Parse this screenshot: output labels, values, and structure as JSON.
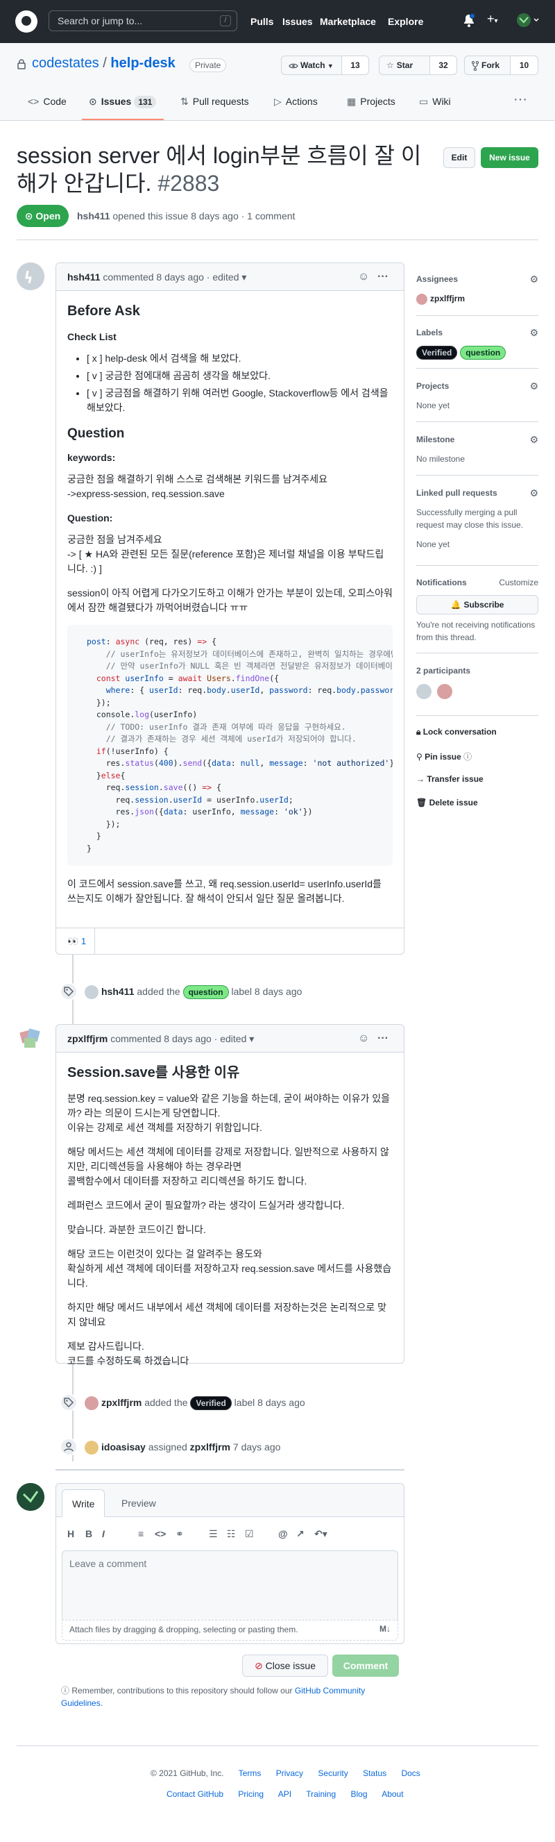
{
  "header": {
    "search_placeholder": "Search or jump to...",
    "slash_key": "/",
    "nav": [
      "Pulls",
      "Issues",
      "Marketplace",
      "Explore"
    ],
    "plus_label": "+",
    "caret": "▾"
  },
  "repo": {
    "owner": "codestates",
    "separator": "/",
    "name": "help-desk",
    "visibility": "Private",
    "watch_label": "Watch",
    "watch_count": "13",
    "star_label": "Star",
    "star_count": "32",
    "fork_label": "Fork",
    "fork_count": "10",
    "tabs": {
      "code": "Code",
      "issues": "Issues",
      "issues_count": "131",
      "pulls": "Pull requests",
      "actions": "Actions",
      "projects": "Projects",
      "wiki": "Wiki"
    }
  },
  "issue": {
    "title": "session server 에서 login부분 흐름이 잘 이해가 안갑니다.",
    "number": "#2883",
    "edit_label": "Edit",
    "new_issue_label": "New issue",
    "state": "Open",
    "author": "hsh411",
    "meta": "opened this issue 8 days ago · 1 comment"
  },
  "comment1": {
    "author": "hsh411",
    "meta": "commented 8 days ago · edited ▾",
    "h_before": "Before Ask",
    "h_checklist": "Check List",
    "checks": [
      "[ x ] help-desk 에서 검색을 해 보았다.",
      "[ v ] 궁금한 점에대해 곰곰히 생각을 해보았다.",
      "[ v ] 궁금점을 해결하기 위해 여러번 Google, Stackoverflow등 에서 검색을 해보았다."
    ],
    "h_question": "Question",
    "h_keywords": "keywords:",
    "keywords_hint": "궁금한 점을 해결하기 위해 스스로 검색해본 키워드를 남겨주세요",
    "keywords_value": "->express-session, req.session.save",
    "h_question2": "Question:",
    "question_hint": "궁금한 점을 남겨주세요",
    "question_note": "-> [ ★ HA와 관련된 모든 질문(reference 포함)은 제너럴 채널을 이용 부탁드립니다. :) ]",
    "question_body": "session이 아직 어렵게 다가오기도하고 이해가 안가는 부분이 있는데, 오피스아워에서 잠깐 해결됐다가 까먹어버렸습니다 ㅠㅠ",
    "after_code": "이 코드에서 session.save를 쓰고, 왜 req.session.userId= userInfo.userId를 쓰는지도 이해가 잘안됩니다. 잘 해석이 안되서 일단 질문 올려봅니다.",
    "reaction_emoji": "👀",
    "reaction_count": "1",
    "code_lines": [
      "post: async (req, res) => {",
      "  // userInfo는 유저정보가 데이터베이스에 존재하고, 완벽히 일치하는 경우에만 데이터가 존재합니다.",
      "  // 만약 userInfo가 NULL 혹은 빈 객체라면 전달받은 유저정보가 데이터베이스에 존재하는지 확인해 보세요",
      "  const userInfo = await Users.findOne({",
      "    where: { userId: req.body.userId, password: req.body.password },",
      "  });",
      "  console.log(userInfo)",
      "  // TODO: userInfo 결과 존재 여부에 따라 응답을 구현하세요.",
      "  // 결과가 존재하는 경우 세션 객체에 userId가 저장되어야 합니다.",
      "  if(!userInfo) {",
      "    res.status(400).send({data: null, message: 'not authorized'});",
      "  }else{",
      "    req.session.save(() => {",
      "      req.session.userId = userInfo.userId;",
      "      res.json({data: userInfo, message: 'ok'})",
      "    });",
      "  }",
      "}"
    ]
  },
  "event1": {
    "actor": "hsh411",
    "text1": "added the",
    "label": "question",
    "text2": "label 8 days ago"
  },
  "comment2": {
    "author": "zpxlffjrm",
    "meta": "commented 8 days ago · edited ▾",
    "h1": "Session.save를 사용한 이유",
    "p1a": "분명 req.session.key = value와 같은 기능을 하는데, 굳이 써야하는 이유가 있을까? 라는 의문이 드시는게 당연합니다.",
    "p1b": "이유는 강제로 세션 객체를 저장하기 위함입니다.",
    "p2a": "해당 메서드는 세션 객체에 데이터를 강제로 저장합니다. 일반적으로 사용하지 않지만, 리디렉션등을 사용해야 하는 경우라면",
    "p2b": "콜백함수에서 데이터를 저장하고 리디렉션을 하기도 합니다.",
    "p3": "레퍼런스 코드에서 굳이 필요할까? 라는 생각이 드실거라 생각합니다.",
    "p4": "맞습니다. 과분한 코드이긴 합니다.",
    "p5a": "해당 코드는 이런것이 있다는 걸 알려주는 용도와",
    "p5b": "확실하게 세션 객체에 데이터를 저장하고자 req.session.save 메서드를 사용했습니다.",
    "p6": "하지만 해당 메서드 내부에서 세션 객체에 데이터를 저장하는것은 논리적으로 맞지 않네요",
    "p7a": "제보 감사드립니다.",
    "p7b": "코드를 수정하도록 하겠습니다"
  },
  "event2": {
    "actor": "zpxlffjrm",
    "text1": "added the",
    "label": "Verified",
    "text2": "label 8 days ago"
  },
  "event3": {
    "actor": "idoasisay",
    "text1": "assigned",
    "target": "zpxlffjrm",
    "text2": "7 days ago"
  },
  "composer": {
    "tab_write": "Write",
    "tab_preview": "Preview",
    "placeholder": "Leave a comment",
    "attach_text": "Attach files by dragging & dropping, selecting or pasting them.",
    "close_label": "Close issue",
    "comment_label": "Comment",
    "notice_text": "Remember, contributions to this repository should follow our",
    "notice_link": "GitHub Community Guidelines",
    "notice_end": "."
  },
  "sidebar": {
    "assignees_title": "Assignees",
    "assignee": "zpxlffjrm",
    "labels_title": "Labels",
    "label_verified": "Verified",
    "label_question": "question",
    "projects_title": "Projects",
    "projects_value": "None yet",
    "milestone_title": "Milestone",
    "milestone_value": "No milestone",
    "linked_title": "Linked pull requests",
    "linked_text": "Successfully merging a pull request may close this issue.",
    "linked_value": "None yet",
    "notifications_title": "Notifications",
    "customize": "Customize",
    "subscribe_label": "Subscribe",
    "notif_text": "You're not receiving notifications from this thread.",
    "participants_title": "2 participants",
    "lock": "Lock conversation",
    "pin": "Pin issue",
    "transfer": "Transfer issue",
    "delete": "Delete issue"
  },
  "footer": {
    "copyright": "© 2021 GitHub, Inc.",
    "row1": [
      "Terms",
      "Privacy",
      "Security",
      "Status",
      "Docs"
    ],
    "row2": [
      "Contact GitHub",
      "Pricing",
      "API",
      "Training",
      "Blog",
      "About"
    ]
  },
  "colors": {
    "accent": "#0969da",
    "open_green": "#2da44e",
    "header_bg": "#24292f",
    "tab_underline": "#fd8c73"
  }
}
